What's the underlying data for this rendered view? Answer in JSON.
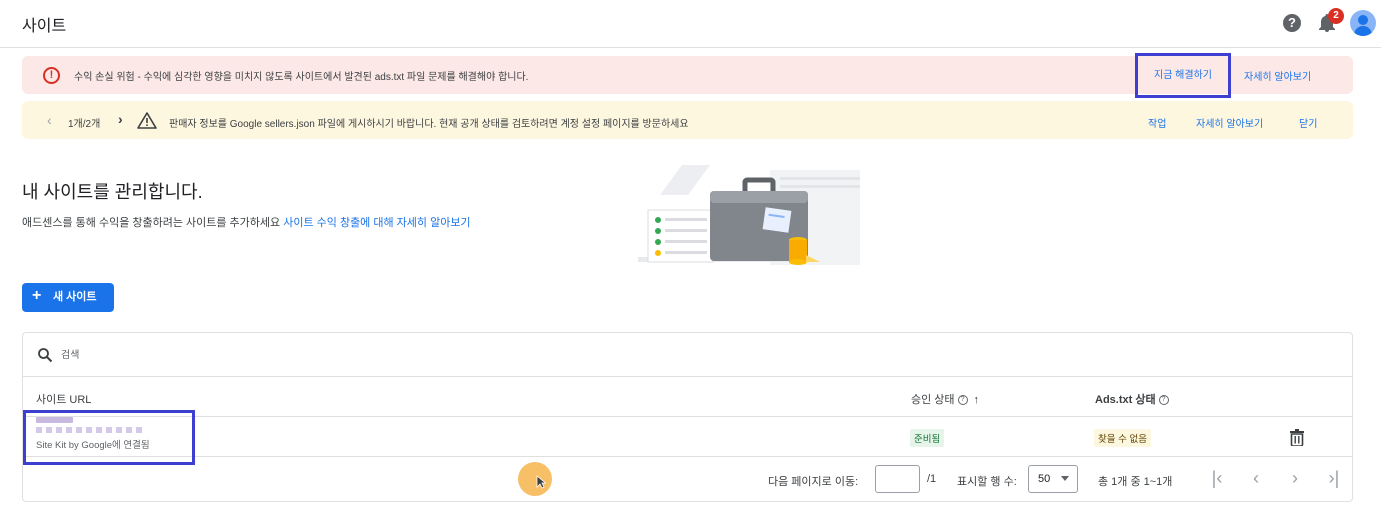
{
  "topbar": {
    "title": "사이트",
    "notification_count": "2",
    "help_glyph": "?"
  },
  "alert_red": {
    "message": "수익 손실 위험 - 수익에 심각한 영향을 미치지 않도록 사이트에서 발견된 ads.txt 파일 문제를 해결해야 합니다.",
    "fix_label": "지금 해결하기",
    "learn_label": "자세히 알아보기",
    "color": "#fce8e6"
  },
  "alert_yellow": {
    "pager": "1개/2개",
    "message": "판매자 정보를 Google sellers.json 파일에 게시하시기 바랍니다. 현재 공개 상태를 검토하려면 계정 설정 페이지를 방문하세요",
    "action_label": "작업",
    "learn_label": "자세히 알아보기",
    "close_label": "닫기",
    "color": "#fef7e0"
  },
  "intro": {
    "heading": "내 사이트를 관리합니다.",
    "description": "애드센스를 통해 수익을 창출하려는 사이트를 추가하세요",
    "link": "사이트 수익 창출에 대해 자세히 알아보기"
  },
  "new_site_button": {
    "label": "새 사이트",
    "color": "#1a73e8"
  },
  "search": {
    "placeholder": "검색"
  },
  "table": {
    "headers": {
      "url": "사이트 URL",
      "approval": "승인 상태",
      "adstxt": "Ads.txt 상태"
    },
    "rows": [
      {
        "sitekit_note": "Site Kit by Google에 연결됨",
        "approval_status": "준비됨",
        "adstxt_status": "찾을 수 없음"
      }
    ]
  },
  "pagination": {
    "goto_label": "다음 페이지로 이동:",
    "goto_value": "",
    "total_pages": "/1",
    "rows_label": "표시할 행 수:",
    "rows_value": "50",
    "range": "총 1개 중 1~1개"
  }
}
